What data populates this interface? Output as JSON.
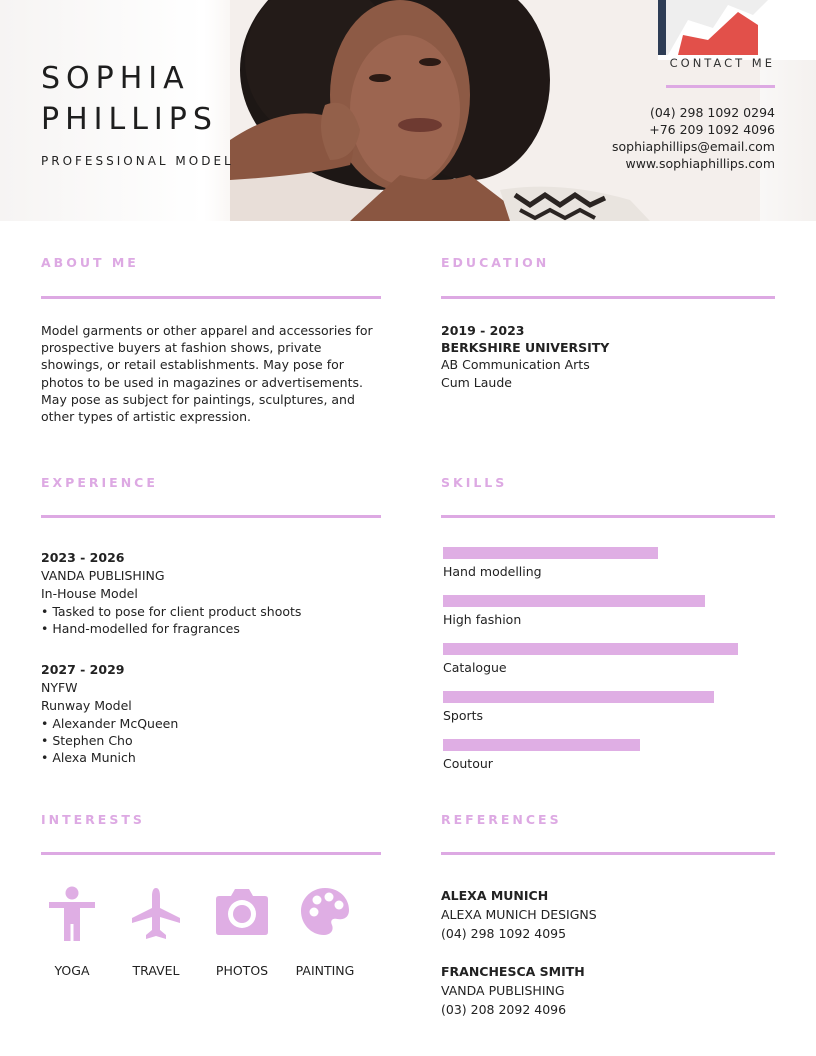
{
  "header": {
    "name_line1": "SOPHIA",
    "name_line2": "PHILLIPS",
    "subtitle": "PROFESSIONAL MODEL"
  },
  "contact": {
    "heading": "CONTACT ME",
    "phone1": "(04) 298 1092 0294",
    "phone2": "+76 209 1092 4096",
    "email": "sophiaphillips@email.com",
    "website": "www.sophiaphillips.com"
  },
  "about": {
    "title": "ABOUT ME",
    "text": "Model garments or other apparel and accessories for prospective buyers at fashion shows, private showings, or retail establishments. May pose for photos to be used in magazines or advertisements. May pose as subject for paintings, sculptures, and other types of artistic expression."
  },
  "education": {
    "title": "EDUCATION",
    "years": "2019 - 2023",
    "school": "BERKSHIRE UNIVERSITY",
    "degree": "AB Communication Arts",
    "honors": "Cum Laude"
  },
  "experience": {
    "title": "EXPERIENCE",
    "jobs": [
      {
        "years": "2023 - 2026",
        "company": "VANDA PUBLISHING",
        "role": "In-House Model",
        "bullets": [
          "• Tasked to pose for client product shoots",
          "• Hand-modelled for fragrances"
        ]
      },
      {
        "years": "2027 - 2029",
        "company": "NYFW",
        "role": "Runway Model",
        "bullets": [
          "• Alexander McQueen",
          "• Stephen Cho",
          "• Alexa Munich"
        ]
      }
    ]
  },
  "skills": {
    "title": "SKILLS",
    "items": [
      {
        "label": "Hand modelling",
        "level": 0.72
      },
      {
        "label": "High fashion",
        "level": 0.88
      },
      {
        "label": "Catalogue",
        "level": 0.99
      },
      {
        "label": "Sports",
        "level": 0.91
      },
      {
        "label": "Coutour",
        "level": 0.66
      }
    ]
  },
  "interests": {
    "title": "INTERESTS",
    "items": [
      {
        "label": "YOGA",
        "icon": "person-icon"
      },
      {
        "label": "TRAVEL",
        "icon": "airplane-icon"
      },
      {
        "label": "PHOTOS",
        "icon": "camera-icon"
      },
      {
        "label": "PAINTING",
        "icon": "palette-icon"
      }
    ]
  },
  "references": {
    "title": "REFERENCES",
    "people": [
      {
        "name": "ALEXA MUNICH",
        "company": "ALEXA MUNICH DESIGNS",
        "phone": "(04) 298 1092 4095"
      },
      {
        "name": "FRANCHESCA SMITH",
        "company": "VANDA PUBLISHING",
        "phone": "(03) 208 2092 4096"
      }
    ]
  },
  "colors": {
    "accent": "#dda9e3",
    "text": "#222222"
  }
}
